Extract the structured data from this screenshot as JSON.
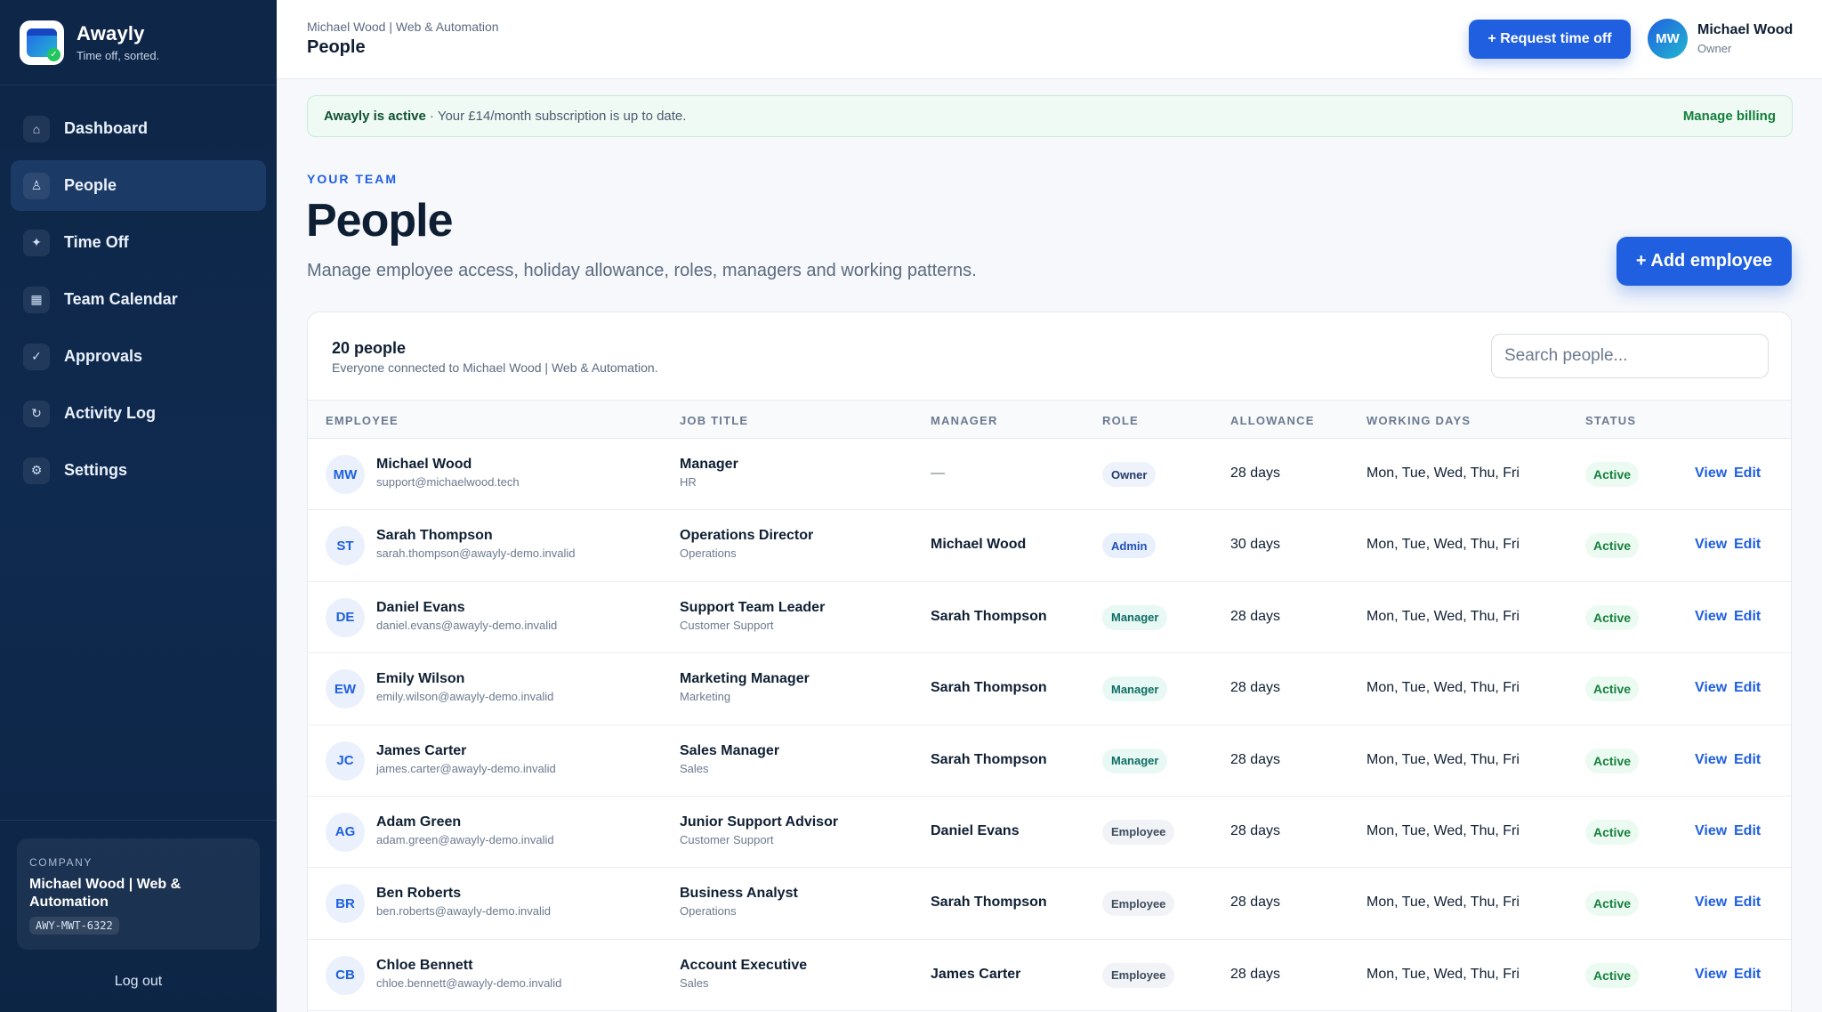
{
  "brand": {
    "name": "Awayly",
    "tagline": "Time off, sorted."
  },
  "nav": [
    {
      "label": "Dashboard",
      "icon": "home-icon",
      "glyph": "⌂",
      "active": false
    },
    {
      "label": "People",
      "icon": "people-icon",
      "glyph": "♙",
      "active": true
    },
    {
      "label": "Time Off",
      "icon": "sparkle-icon",
      "glyph": "✦",
      "active": false
    },
    {
      "label": "Team Calendar",
      "icon": "calendar-icon",
      "glyph": "▦",
      "active": false
    },
    {
      "label": "Approvals",
      "icon": "check-icon",
      "glyph": "✓",
      "active": false
    },
    {
      "label": "Activity Log",
      "icon": "history-icon",
      "glyph": "↻",
      "active": false
    },
    {
      "label": "Settings",
      "icon": "gear-icon",
      "glyph": "⚙",
      "active": false
    }
  ],
  "company": {
    "kicker": "COMPANY",
    "name": "Michael Wood | Web & Automation",
    "code": "AWY-MWT-6322"
  },
  "logout_label": "Log out",
  "topbar": {
    "breadcrumb": "Michael Wood | Web & Automation",
    "title": "People",
    "request_label": "+ Request time off",
    "user_initials": "MW",
    "user_name": "Michael Wood",
    "user_role": "Owner"
  },
  "banner": {
    "strong": "Awayly is active",
    "text": "Your £14/month subscription is up to date.",
    "link": "Manage billing"
  },
  "header": {
    "kicker": "YOUR TEAM",
    "title": "People",
    "subtitle": "Manage employee access, holiday allowance, roles, managers and working patterns.",
    "add_label": "+ Add employee"
  },
  "table": {
    "count": "20 people",
    "count_sub": "Everyone connected to Michael Wood | Web & Automation.",
    "search_placeholder": "Search people...",
    "columns": [
      "EMPLOYEE",
      "JOB TITLE",
      "MANAGER",
      "ROLE",
      "ALLOWANCE",
      "WORKING DAYS",
      "STATUS"
    ],
    "action_view": "View",
    "action_edit": "Edit",
    "rows": [
      {
        "initials": "MW",
        "name": "Michael Wood",
        "email": "support@michaelwood.tech",
        "job": "Manager",
        "dept": "HR",
        "manager": "—",
        "role": "Owner",
        "allowance": "28 days",
        "days": "Mon, Tue, Wed, Thu, Fri",
        "status": "Active"
      },
      {
        "initials": "ST",
        "name": "Sarah Thompson",
        "email": "sarah.thompson@awayly-demo.invalid",
        "job": "Operations Director",
        "dept": "Operations",
        "manager": "Michael Wood",
        "role": "Admin",
        "allowance": "30 days",
        "days": "Mon, Tue, Wed, Thu, Fri",
        "status": "Active"
      },
      {
        "initials": "DE",
        "name": "Daniel Evans",
        "email": "daniel.evans@awayly-demo.invalid",
        "job": "Support Team Leader",
        "dept": "Customer Support",
        "manager": "Sarah Thompson",
        "role": "Manager",
        "allowance": "28 days",
        "days": "Mon, Tue, Wed, Thu, Fri",
        "status": "Active"
      },
      {
        "initials": "EW",
        "name": "Emily Wilson",
        "email": "emily.wilson@awayly-demo.invalid",
        "job": "Marketing Manager",
        "dept": "Marketing",
        "manager": "Sarah Thompson",
        "role": "Manager",
        "allowance": "28 days",
        "days": "Mon, Tue, Wed, Thu, Fri",
        "status": "Active"
      },
      {
        "initials": "JC",
        "name": "James Carter",
        "email": "james.carter@awayly-demo.invalid",
        "job": "Sales Manager",
        "dept": "Sales",
        "manager": "Sarah Thompson",
        "role": "Manager",
        "allowance": "28 days",
        "days": "Mon, Tue, Wed, Thu, Fri",
        "status": "Active"
      },
      {
        "initials": "AG",
        "name": "Adam Green",
        "email": "adam.green@awayly-demo.invalid",
        "job": "Junior Support Advisor",
        "dept": "Customer Support",
        "manager": "Daniel Evans",
        "role": "Employee",
        "allowance": "28 days",
        "days": "Mon, Tue, Wed, Thu, Fri",
        "status": "Active"
      },
      {
        "initials": "BR",
        "name": "Ben Roberts",
        "email": "ben.roberts@awayly-demo.invalid",
        "job": "Business Analyst",
        "dept": "Operations",
        "manager": "Sarah Thompson",
        "role": "Employee",
        "allowance": "28 days",
        "days": "Mon, Tue, Wed, Thu, Fri",
        "status": "Active"
      },
      {
        "initials": "CB",
        "name": "Chloe Bennett",
        "email": "chloe.bennett@awayly-demo.invalid",
        "job": "Account Executive",
        "dept": "Sales",
        "manager": "James Carter",
        "role": "Employee",
        "allowance": "28 days",
        "days": "Mon, Tue, Wed, Thu, Fri",
        "status": "Active"
      }
    ]
  },
  "colors": {
    "accent": "#1f5fe0",
    "sidebar": "#0e2647",
    "success": "#15803d"
  }
}
